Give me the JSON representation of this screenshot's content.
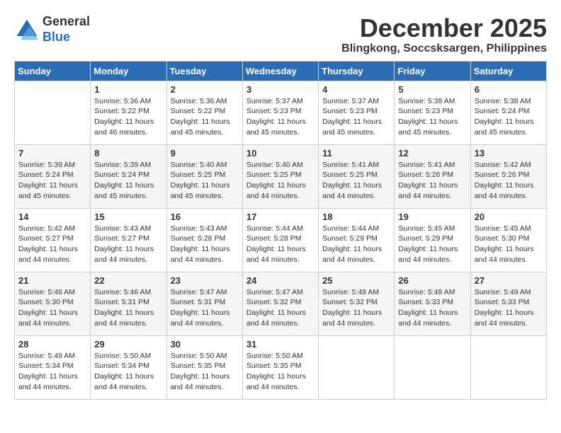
{
  "logo": {
    "general": "General",
    "blue": "Blue"
  },
  "title": "December 2025",
  "location": "Blingkong, Soccsksargen, Philippines",
  "days_of_week": [
    "Sunday",
    "Monday",
    "Tuesday",
    "Wednesday",
    "Thursday",
    "Friday",
    "Saturday"
  ],
  "weeks": [
    [
      {
        "day": "",
        "sunrise": "",
        "sunset": "",
        "daylight": ""
      },
      {
        "day": "1",
        "sunrise": "5:36 AM",
        "sunset": "5:22 PM",
        "daylight": "11 hours and 46 minutes."
      },
      {
        "day": "2",
        "sunrise": "5:36 AM",
        "sunset": "5:22 PM",
        "daylight": "11 hours and 45 minutes."
      },
      {
        "day": "3",
        "sunrise": "5:37 AM",
        "sunset": "5:23 PM",
        "daylight": "11 hours and 45 minutes."
      },
      {
        "day": "4",
        "sunrise": "5:37 AM",
        "sunset": "5:23 PM",
        "daylight": "11 hours and 45 minutes."
      },
      {
        "day": "5",
        "sunrise": "5:38 AM",
        "sunset": "5:23 PM",
        "daylight": "11 hours and 45 minutes."
      },
      {
        "day": "6",
        "sunrise": "5:38 AM",
        "sunset": "5:24 PM",
        "daylight": "11 hours and 45 minutes."
      }
    ],
    [
      {
        "day": "7",
        "sunrise": "5:39 AM",
        "sunset": "5:24 PM",
        "daylight": "11 hours and 45 minutes."
      },
      {
        "day": "8",
        "sunrise": "5:39 AM",
        "sunset": "5:24 PM",
        "daylight": "11 hours and 45 minutes."
      },
      {
        "day": "9",
        "sunrise": "5:40 AM",
        "sunset": "5:25 PM",
        "daylight": "11 hours and 45 minutes."
      },
      {
        "day": "10",
        "sunrise": "5:40 AM",
        "sunset": "5:25 PM",
        "daylight": "11 hours and 44 minutes."
      },
      {
        "day": "11",
        "sunrise": "5:41 AM",
        "sunset": "5:25 PM",
        "daylight": "11 hours and 44 minutes."
      },
      {
        "day": "12",
        "sunrise": "5:41 AM",
        "sunset": "5:26 PM",
        "daylight": "11 hours and 44 minutes."
      },
      {
        "day": "13",
        "sunrise": "5:42 AM",
        "sunset": "5:26 PM",
        "daylight": "11 hours and 44 minutes."
      }
    ],
    [
      {
        "day": "14",
        "sunrise": "5:42 AM",
        "sunset": "5:27 PM",
        "daylight": "11 hours and 44 minutes."
      },
      {
        "day": "15",
        "sunrise": "5:43 AM",
        "sunset": "5:27 PM",
        "daylight": "11 hours and 44 minutes."
      },
      {
        "day": "16",
        "sunrise": "5:43 AM",
        "sunset": "5:28 PM",
        "daylight": "11 hours and 44 minutes."
      },
      {
        "day": "17",
        "sunrise": "5:44 AM",
        "sunset": "5:28 PM",
        "daylight": "11 hours and 44 minutes."
      },
      {
        "day": "18",
        "sunrise": "5:44 AM",
        "sunset": "5:29 PM",
        "daylight": "11 hours and 44 minutes."
      },
      {
        "day": "19",
        "sunrise": "5:45 AM",
        "sunset": "5:29 PM",
        "daylight": "11 hours and 44 minutes."
      },
      {
        "day": "20",
        "sunrise": "5:45 AM",
        "sunset": "5:30 PM",
        "daylight": "11 hours and 44 minutes."
      }
    ],
    [
      {
        "day": "21",
        "sunrise": "5:46 AM",
        "sunset": "5:30 PM",
        "daylight": "11 hours and 44 minutes."
      },
      {
        "day": "22",
        "sunrise": "5:46 AM",
        "sunset": "5:31 PM",
        "daylight": "11 hours and 44 minutes."
      },
      {
        "day": "23",
        "sunrise": "5:47 AM",
        "sunset": "5:31 PM",
        "daylight": "11 hours and 44 minutes."
      },
      {
        "day": "24",
        "sunrise": "5:47 AM",
        "sunset": "5:32 PM",
        "daylight": "11 hours and 44 minutes."
      },
      {
        "day": "25",
        "sunrise": "5:48 AM",
        "sunset": "5:32 PM",
        "daylight": "11 hours and 44 minutes."
      },
      {
        "day": "26",
        "sunrise": "5:48 AM",
        "sunset": "5:33 PM",
        "daylight": "11 hours and 44 minutes."
      },
      {
        "day": "27",
        "sunrise": "5:49 AM",
        "sunset": "5:33 PM",
        "daylight": "11 hours and 44 minutes."
      }
    ],
    [
      {
        "day": "28",
        "sunrise": "5:49 AM",
        "sunset": "5:34 PM",
        "daylight": "11 hours and 44 minutes."
      },
      {
        "day": "29",
        "sunrise": "5:50 AM",
        "sunset": "5:34 PM",
        "daylight": "11 hours and 44 minutes."
      },
      {
        "day": "30",
        "sunrise": "5:50 AM",
        "sunset": "5:35 PM",
        "daylight": "11 hours and 44 minutes."
      },
      {
        "day": "31",
        "sunrise": "5:50 AM",
        "sunset": "5:35 PM",
        "daylight": "11 hours and 44 minutes."
      },
      {
        "day": "",
        "sunrise": "",
        "sunset": "",
        "daylight": ""
      },
      {
        "day": "",
        "sunrise": "",
        "sunset": "",
        "daylight": ""
      },
      {
        "day": "",
        "sunrise": "",
        "sunset": "",
        "daylight": ""
      }
    ]
  ]
}
